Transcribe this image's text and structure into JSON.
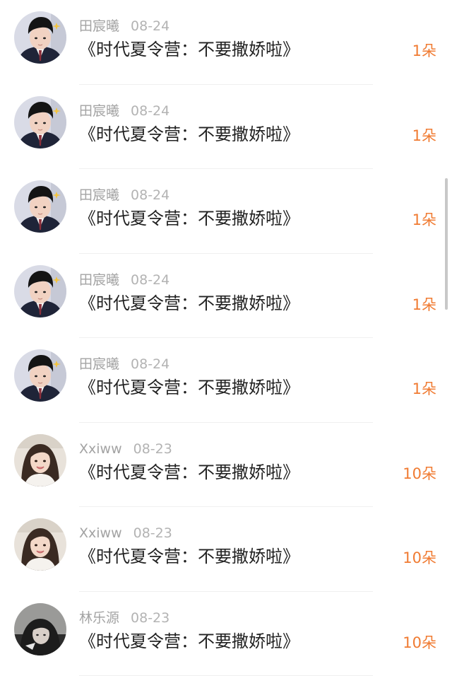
{
  "theme": {
    "accent": "#f07b32",
    "name_color": "#a3a3a3",
    "title_color": "#222222"
  },
  "gifts": [
    {
      "name": "田宸曦",
      "date": "08-24",
      "title": "《时代夏令营：不要撒娇啦》",
      "count": "1朵",
      "avatar": "boy-avatar"
    },
    {
      "name": "田宸曦",
      "date": "08-24",
      "title": "《时代夏令营：不要撒娇啦》",
      "count": "1朵",
      "avatar": "boy-avatar"
    },
    {
      "name": "田宸曦",
      "date": "08-24",
      "title": "《时代夏令营：不要撒娇啦》",
      "count": "1朵",
      "avatar": "boy-avatar"
    },
    {
      "name": "田宸曦",
      "date": "08-24",
      "title": "《时代夏令营：不要撒娇啦》",
      "count": "1朵",
      "avatar": "boy-avatar"
    },
    {
      "name": "田宸曦",
      "date": "08-24",
      "title": "《时代夏令营：不要撒娇啦》",
      "count": "1朵",
      "avatar": "boy-avatar"
    },
    {
      "name": "Xxiww",
      "date": "08-23",
      "title": "《时代夏令营：不要撒娇啦》",
      "count": "10朵",
      "avatar": "girl-avatar"
    },
    {
      "name": "Xxiww",
      "date": "08-23",
      "title": "《时代夏令营：不要撒娇啦》",
      "count": "10朵",
      "avatar": "girl-avatar"
    },
    {
      "name": "林乐源",
      "date": "08-23",
      "title": "《时代夏令营：不要撒娇啦》",
      "count": "10朵",
      "avatar": "dark-photo-avatar"
    }
  ]
}
